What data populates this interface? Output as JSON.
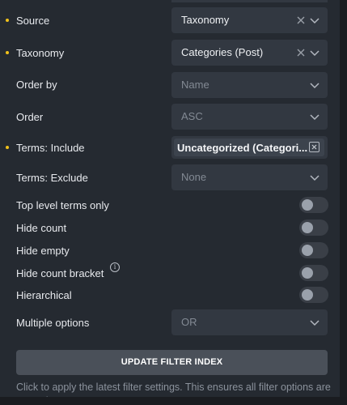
{
  "fields": {
    "source": {
      "label": "Source",
      "value": "Taxonomy"
    },
    "taxonomy": {
      "label": "Taxonomy",
      "value": "Categories (Post)"
    },
    "order_by": {
      "label": "Order by",
      "placeholder": "Name"
    },
    "order": {
      "label": "Order",
      "placeholder": "ASC"
    },
    "terms_include": {
      "label": "Terms: Include",
      "tag": "Uncategorized (Categori..."
    },
    "terms_exclude": {
      "label": "Terms: Exclude",
      "placeholder": "None"
    },
    "top_level_only": {
      "label": "Top level terms only",
      "enabled": false
    },
    "hide_count": {
      "label": "Hide count",
      "enabled": false
    },
    "hide_empty": {
      "label": "Hide empty",
      "enabled": false
    },
    "hide_count_bracket": {
      "label": "Hide count bracket",
      "enabled": false,
      "info_icon": "i"
    },
    "hierarchical": {
      "label": "Hierarchical",
      "enabled": false
    },
    "multiple_options": {
      "label": "Multiple options",
      "placeholder": "OR"
    }
  },
  "update_button": {
    "label": "UPDATE FILTER INDEX"
  },
  "help_text": "Click to apply the latest filter settings. This ensures all filter options are up-to-date.",
  "colors": {
    "panel_bg": "#252a31",
    "control_bg": "#323841",
    "accent_dot": "#f1c21b",
    "button_bg": "#4a5059"
  }
}
